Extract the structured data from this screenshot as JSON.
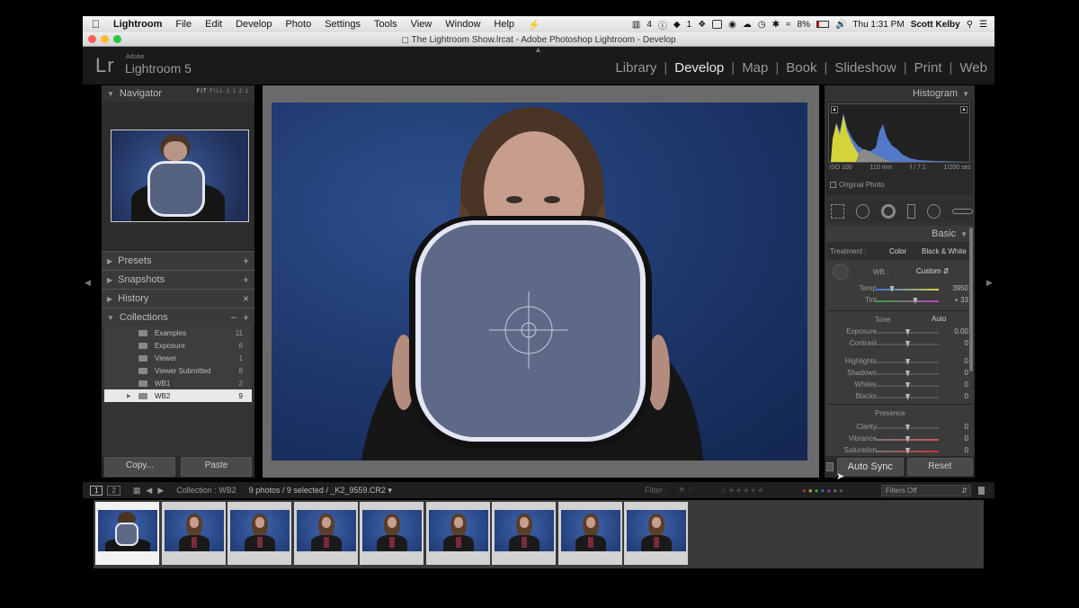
{
  "menubar": {
    "items": [
      "Lightroom",
      "File",
      "Edit",
      "Develop",
      "Photo",
      "Settings",
      "Tools",
      "View",
      "Window",
      "Help"
    ],
    "battery": "8%",
    "clock": "Thu 1:31 PM",
    "user": "Scott Kelby",
    "status_a": "4",
    "status_b": "1"
  },
  "titlebar": {
    "title": "The Lightroom Show.lrcat - Adobe Photoshop Lightroom - Develop"
  },
  "branding": {
    "lr": "Lr",
    "adobe": "Adobe",
    "product": "Lightroom 5"
  },
  "modules": [
    "Library",
    "Develop",
    "Map",
    "Book",
    "Slideshow",
    "Print",
    "Web"
  ],
  "left_panel": {
    "navigator": {
      "label": "Navigator",
      "sizes": [
        "FIT",
        "FILL",
        "1:1",
        "2:1"
      ]
    },
    "presets": "Presets",
    "snapshots": "Snapshots",
    "history": "History",
    "collections": {
      "label": "Collections",
      "items": [
        {
          "name": "Examples",
          "count": "11"
        },
        {
          "name": "Exposure",
          "count": "6"
        },
        {
          "name": "Viewer",
          "count": "1"
        },
        {
          "name": "Viewer Submitted",
          "count": "8"
        },
        {
          "name": "WB1",
          "count": "2"
        },
        {
          "name": "WB2",
          "count": "9"
        }
      ]
    },
    "copy_label": "Copy...",
    "paste_label": "Paste"
  },
  "right_panel": {
    "histogram": {
      "label": "Histogram",
      "iso": "ISO 100",
      "focal": "110 mm",
      "aperture": "f / 7.1",
      "shutter": "1/200 sec",
      "original": "Original Photo"
    },
    "basic": {
      "label": "Basic",
      "treatment_label": "Treatment :",
      "treatment_color": "Color",
      "treatment_bw": "Black & White",
      "wb_label": "WB :",
      "wb_value": "Custom",
      "tone_label": "Tone",
      "auto": "Auto",
      "presence_label": "Presence",
      "sliders": [
        {
          "label": "Temp",
          "value": "3950",
          "pos": 0.25
        },
        {
          "label": "Tint",
          "value": "+ 33",
          "pos": 0.62
        },
        {
          "label": "Exposure",
          "value": "0.00",
          "pos": 0.5
        },
        {
          "label": "Contrast",
          "value": "0",
          "pos": 0.5
        },
        {
          "label": "Highlights",
          "value": "0",
          "pos": 0.5
        },
        {
          "label": "Shadows",
          "value": "0",
          "pos": 0.5
        },
        {
          "label": "Whites",
          "value": "0",
          "pos": 0.5
        },
        {
          "label": "Blacks",
          "value": "0",
          "pos": 0.5
        },
        {
          "label": "Clarity",
          "value": "0",
          "pos": 0.5
        },
        {
          "label": "Vibrance",
          "value": "0",
          "pos": 0.5
        },
        {
          "label": "Saturation",
          "value": "0",
          "pos": 0.5
        }
      ]
    },
    "auto_sync": "Auto Sync",
    "reset": "Reset"
  },
  "filter_bar": {
    "page1": "1",
    "page2": "2",
    "collection": "Collection : WB2",
    "count": "9 photos / 9 selected / _K2_9559.CR2",
    "filter_label": "Filter :",
    "filters_off": "Filters Off"
  },
  "filmstrip_count": 9
}
